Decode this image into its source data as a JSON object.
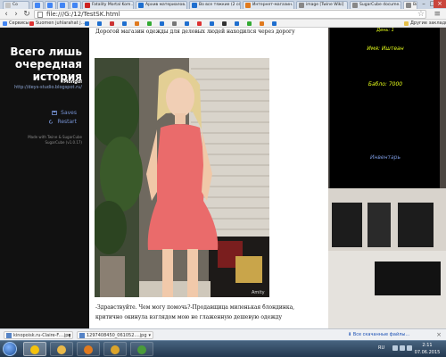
{
  "browser": {
    "tabs": [
      {
        "label": "Со",
        "color": "#c4c4c4"
      },
      {
        "label": "",
        "color": "#4285f4"
      },
      {
        "label": "",
        "color": "#4285f4"
      },
      {
        "label": "",
        "color": "#4285f4"
      },
      {
        "label": "",
        "color": "#4285f4"
      },
      {
        "label": "Fatality Mortal Kom…",
        "color": "#cc2222"
      },
      {
        "label": "Архив материалов…",
        "color": "#1f6fcf"
      },
      {
        "label": "Во все тяжкие (2 се…",
        "color": "#1f6fcf"
      },
      {
        "label": "Интернет-магазин…",
        "color": "#e07a1f"
      },
      {
        "label": "image [Twine Wiki]",
        "color": "#888888"
      },
      {
        "label": "SugarCube docume…",
        "color": "#888888"
      },
      {
        "label": "Во…",
        "color": "#888888",
        "active": true
      }
    ],
    "url": "file:///G:/12/TestSK.html",
    "bookmarks": [
      {
        "label": "Сервисы",
        "color": "#4285f4"
      },
      {
        "label": "Suomen juhlarahat j…",
        "color": "#d33"
      },
      {
        "label": "",
        "color": "#1f6fcf"
      },
      {
        "label": "",
        "color": "#1f6fcf"
      },
      {
        "label": "",
        "color": "#c33"
      },
      {
        "label": "",
        "color": "#1f6fcf"
      },
      {
        "label": "",
        "color": "#e07a1f"
      },
      {
        "label": "",
        "color": "#3a3"
      },
      {
        "label": "",
        "color": "#1f6fcf"
      },
      {
        "label": "",
        "color": "#777"
      },
      {
        "label": "",
        "color": "#1f6fcf"
      },
      {
        "label": "",
        "color": "#d33"
      },
      {
        "label": "",
        "color": "#1f6fcf"
      },
      {
        "label": "",
        "color": "#333"
      },
      {
        "label": "",
        "color": "#1f6fcf"
      },
      {
        "label": "",
        "color": "#3a3"
      },
      {
        "label": "",
        "color": "#e07a1f"
      },
      {
        "label": "",
        "color": "#1f6fcf"
      }
    ],
    "other_bookmarks": "Другие закладки"
  },
  "sidebar": {
    "title": "Всего лишь очередная история",
    "author": "Mongol",
    "link": "http://deys-studio.blogspot.ru/",
    "saves_label": "Saves",
    "restart_label": "Restart",
    "credits_line1": "Made with Twine & SugarCube",
    "credits_line2": "SugarCube (v1.0.17)"
  },
  "stats": {
    "top_line": "День: 1",
    "name_label": "Имя: Иштеан",
    "money_label": "Бабло: 7000",
    "inventory_label": "Инвентарь"
  },
  "passage": {
    "intro": "Дорогой магазин одежды для деловых людей находился через дорогу",
    "text": "-Здравствуйте. Чем могу помочь?-Продавщица миленькая блондинка, критично окинула взглядом мою не глаженную дешевую одежду",
    "image_watermark": "Amity"
  },
  "downloads": {
    "items": [
      {
        "label": "kinopoisk.ru-Claire-F....jpg"
      },
      {
        "label": "1297408450_061052....jpg"
      }
    ],
    "all_label": "Все скачанные файлы…"
  },
  "taskbar": {
    "apps": [
      {
        "name": "chrome-icon",
        "color": "#f4c20d"
      },
      {
        "name": "explorer-icon",
        "color": "#e9b94a"
      },
      {
        "name": "media-player-icon",
        "color": "#e07a1f"
      },
      {
        "name": "warning-app-icon",
        "color": "#dba42a"
      },
      {
        "name": "twine-icon",
        "color": "#4a9b3a"
      }
    ],
    "language": "RU",
    "time": "2:11",
    "date": "07.06.2015"
  }
}
